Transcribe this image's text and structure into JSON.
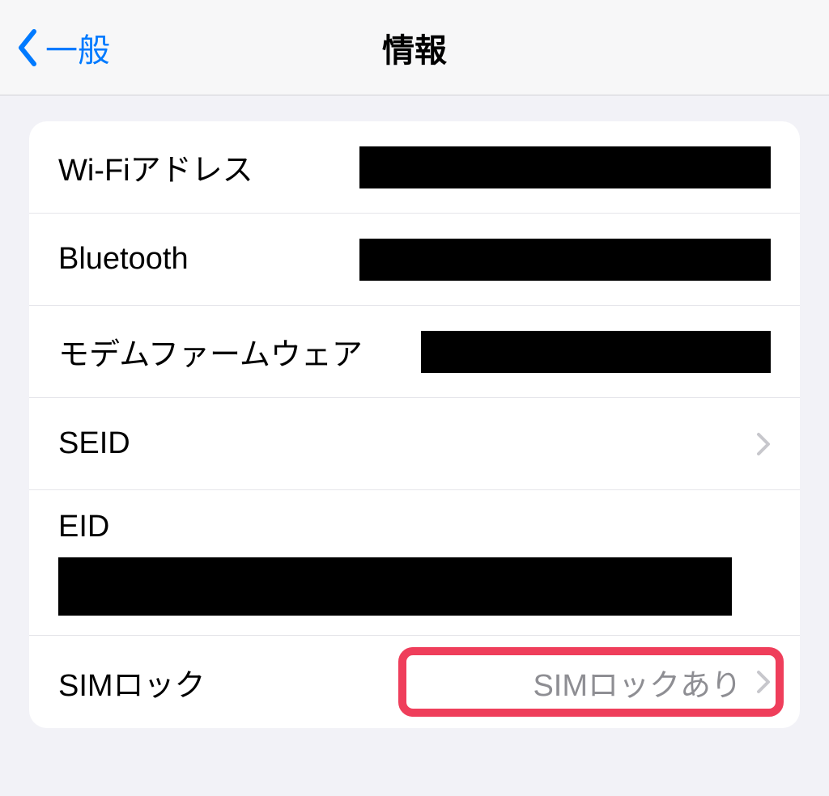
{
  "navbar": {
    "back_label": "一般",
    "title": "情報"
  },
  "rows": {
    "wifi_label": "Wi-Fiアドレス",
    "bluetooth_label": "Bluetooth",
    "modem_label": "モデムファームウェア",
    "seid_label": "SEID",
    "eid_label": "EID",
    "simlock_label": "SIMロック",
    "simlock_value": "SIMロックあり"
  }
}
